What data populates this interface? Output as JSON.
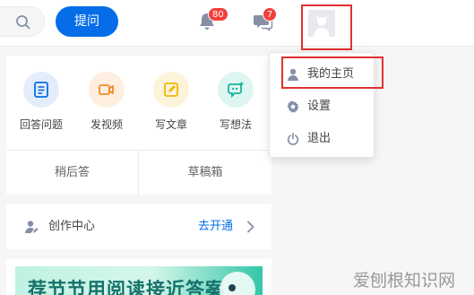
{
  "header": {
    "ask_label": "提问",
    "notifications_count": "80",
    "messages_count": "7"
  },
  "creation": {
    "actions": [
      {
        "label": "回答问题",
        "icon": "answer-doc-icon"
      },
      {
        "label": "发视频",
        "icon": "video-camera-icon"
      },
      {
        "label": "写文章",
        "icon": "pencil-edit-icon"
      },
      {
        "label": "写想法",
        "icon": "thought-bubble-icon"
      }
    ],
    "later_label": "稍后答",
    "drafts_label": "草稿箱"
  },
  "creator_center": {
    "title": "创作中心",
    "link": "去开通"
  },
  "banner": {
    "text": "荐节节用阅读接近答案"
  },
  "menu": {
    "items": [
      {
        "label": "我的主页",
        "icon": "user-icon"
      },
      {
        "label": "设置",
        "icon": "gear-icon"
      },
      {
        "label": "退出",
        "icon": "power-icon"
      }
    ]
  },
  "watermark": "爱刨根知识网",
  "colors": {
    "primary": "#056de8",
    "badge": "#f1403c",
    "annotation": "#e03131"
  }
}
